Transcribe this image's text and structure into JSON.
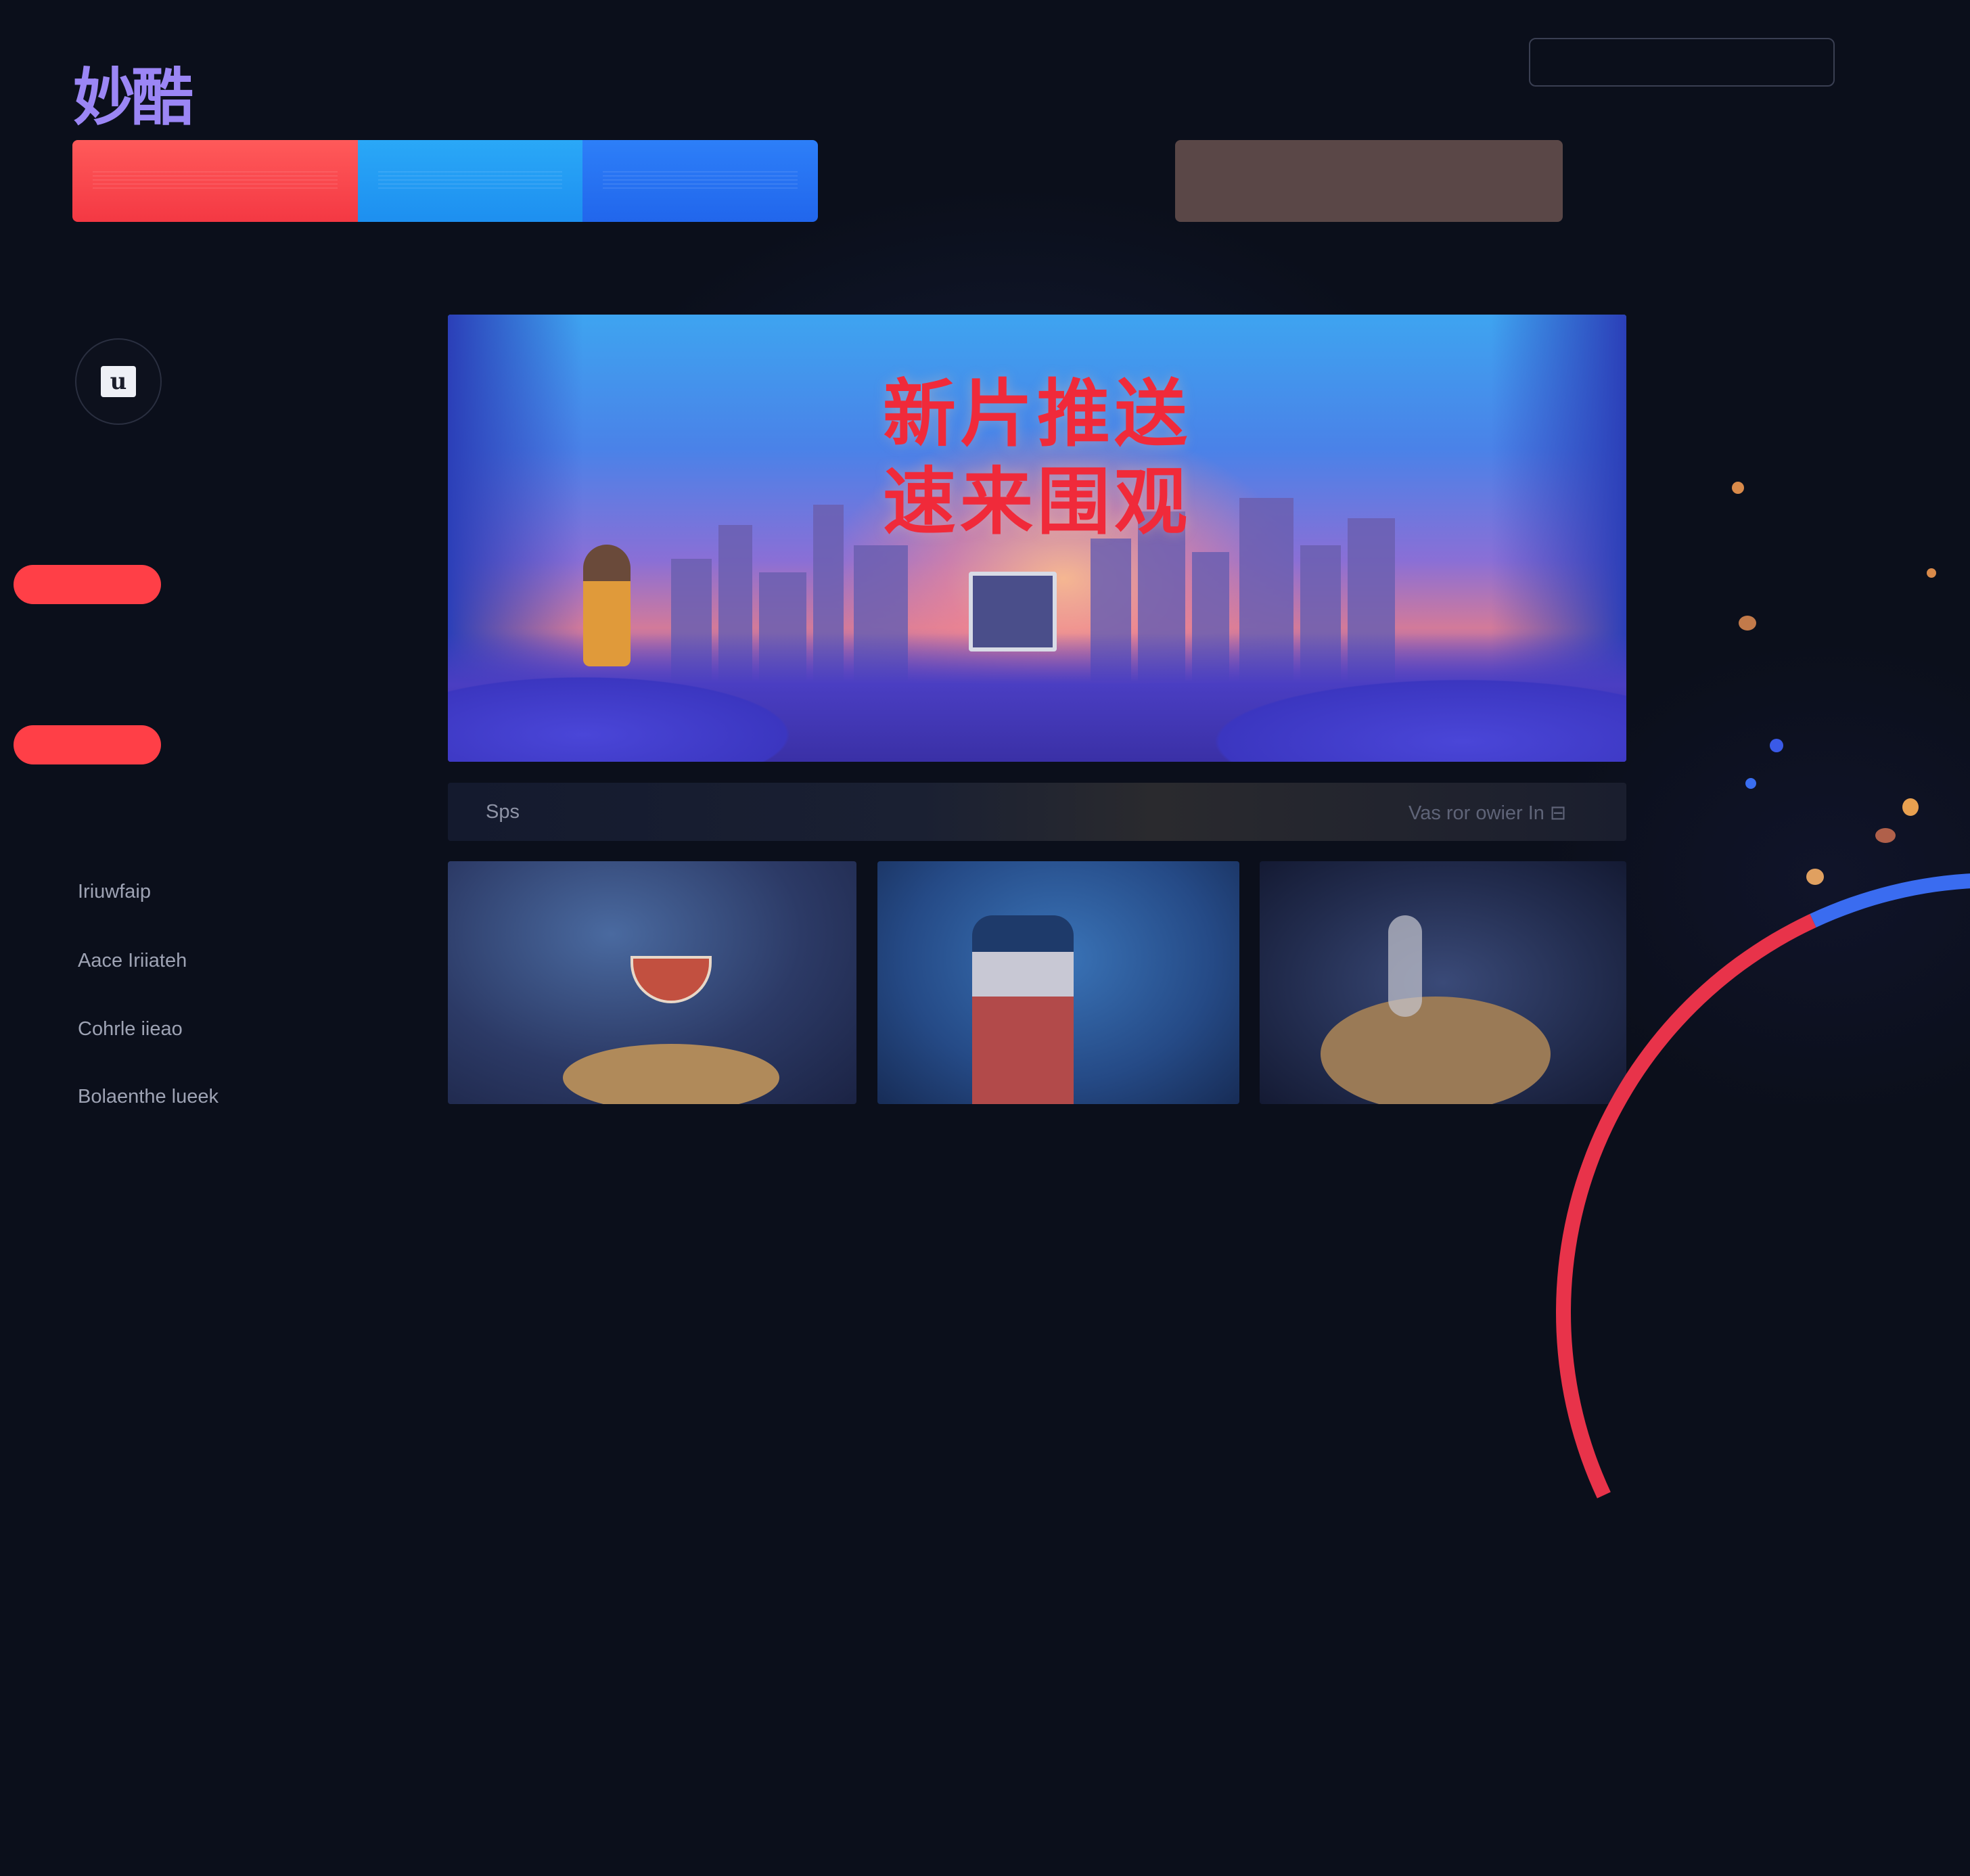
{
  "header": {
    "logo_text": "妙酷",
    "search_placeholder": ""
  },
  "nav": {
    "segments": [
      {
        "label": "",
        "color": "#f43843"
      },
      {
        "label": "",
        "color": "#1d8ff0"
      },
      {
        "label": "",
        "color": "#2166ec"
      }
    ],
    "secondary_button_label": "",
    "secondary_button_color": "#5a4747"
  },
  "sidebar": {
    "icon_glyph": "u",
    "items": [
      "Iriuwfaip",
      "Aace Iriiateh",
      "Cohrle iieao",
      "Bolaenthe lueek"
    ]
  },
  "banner": {
    "title_line1": "新片推送",
    "title_line2": "速来围观",
    "title_color": "#f02a3a"
  },
  "section_bar": {
    "left_label": "Sps",
    "right_label": "Vas ror owier In ⊟"
  },
  "colors": {
    "background": "#0b0f1b",
    "accent_red": "#ff3f47",
    "logo_purple": "#9b86f5"
  }
}
